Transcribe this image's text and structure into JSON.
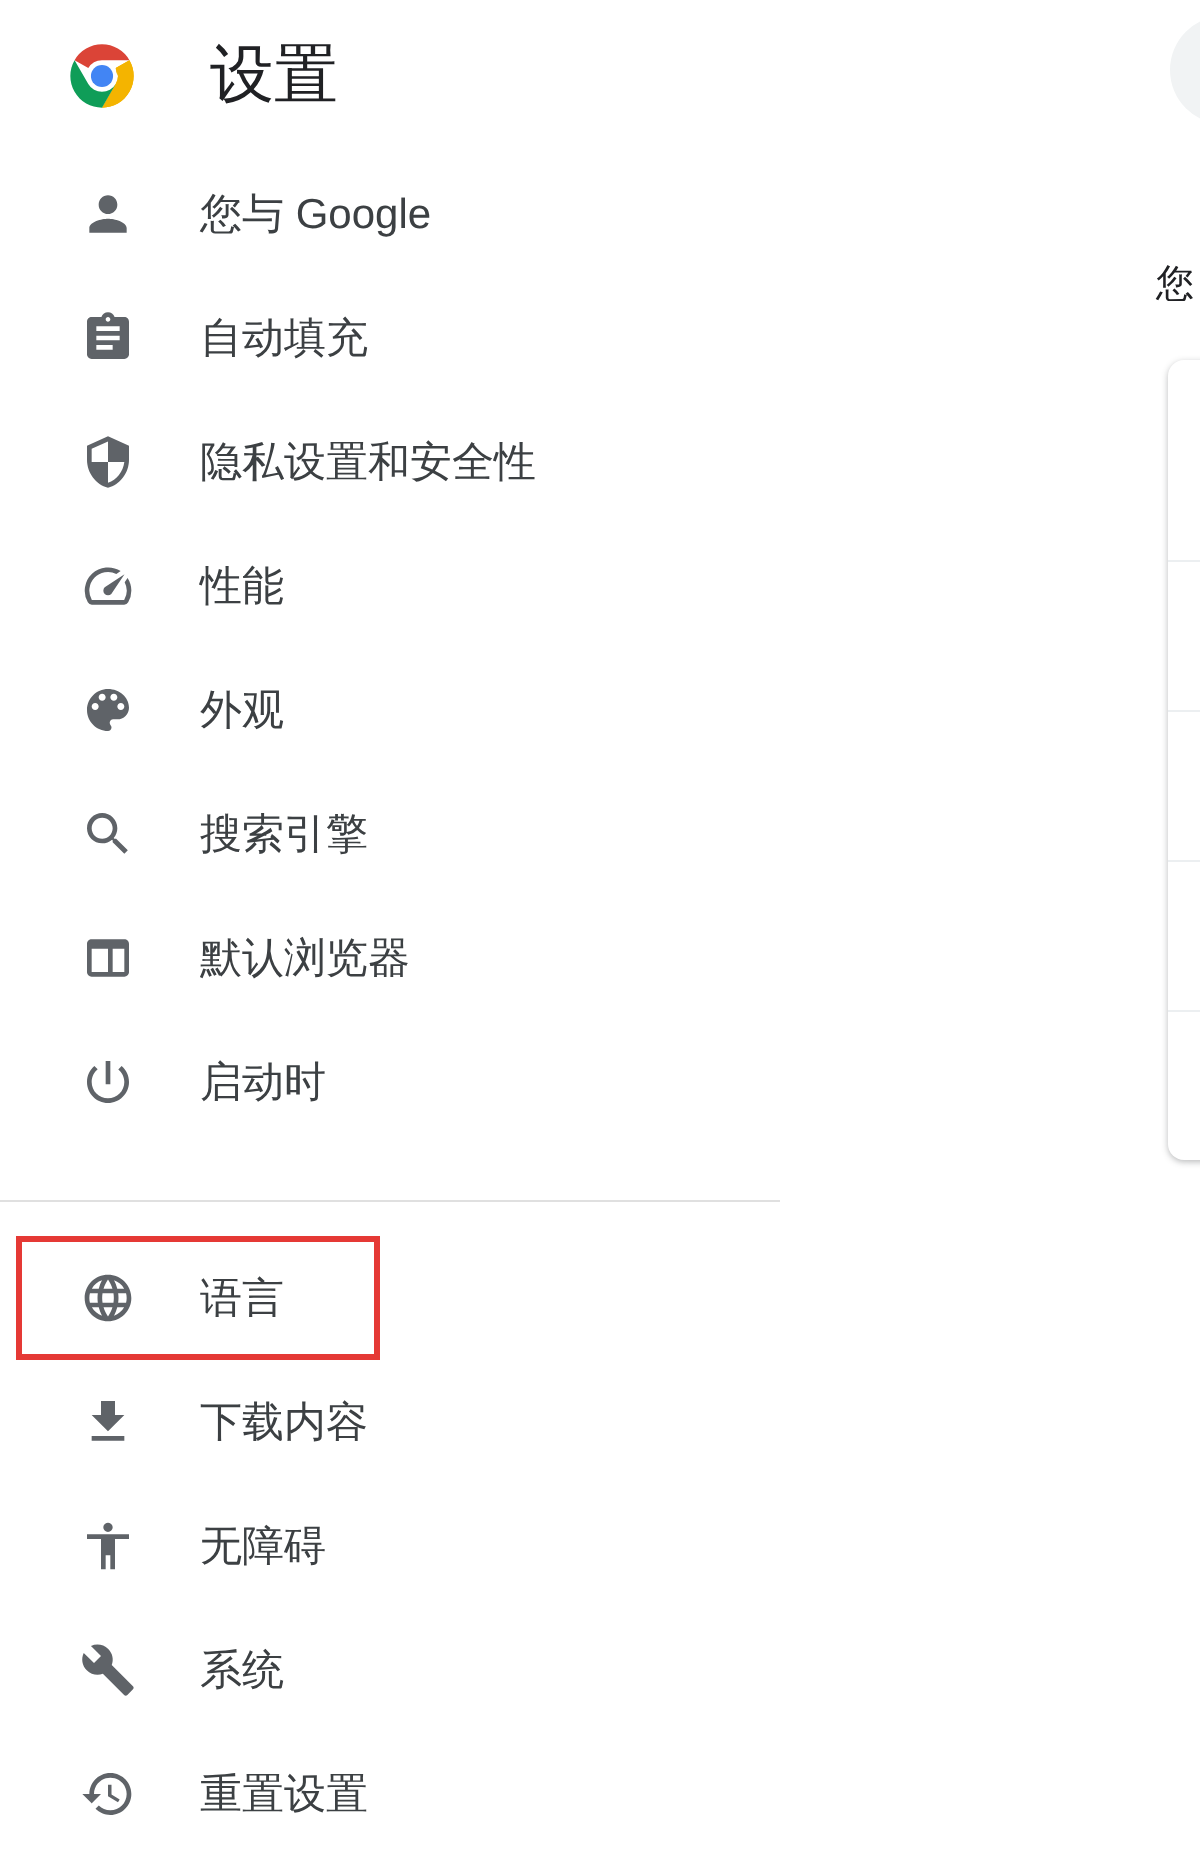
{
  "header": {
    "title": "设置"
  },
  "sidebar": {
    "groups": [
      {
        "items": [
          {
            "label": "您与 Google",
            "kind": "person",
            "highlighted": false
          },
          {
            "label": "自动填充",
            "kind": "autofill",
            "highlighted": false
          },
          {
            "label": "隐私设置和安全性",
            "kind": "privacy",
            "highlighted": false
          },
          {
            "label": "性能",
            "kind": "performance",
            "highlighted": false
          },
          {
            "label": "外观",
            "kind": "appearance",
            "highlighted": false
          },
          {
            "label": "搜索引擎",
            "kind": "search",
            "highlighted": false
          },
          {
            "label": "默认浏览器",
            "kind": "browser",
            "highlighted": false
          },
          {
            "label": "启动时",
            "kind": "startup",
            "highlighted": false
          }
        ]
      },
      {
        "items": [
          {
            "label": "语言",
            "kind": "language",
            "highlighted": true
          },
          {
            "label": "下载内容",
            "kind": "downloads",
            "highlighted": false
          },
          {
            "label": "无障碍",
            "kind": "accessibility",
            "highlighted": false
          },
          {
            "label": "系统",
            "kind": "system",
            "highlighted": false
          },
          {
            "label": "重置设置",
            "kind": "reset",
            "highlighted": false
          }
        ]
      }
    ]
  },
  "main": {
    "heading": "您"
  }
}
